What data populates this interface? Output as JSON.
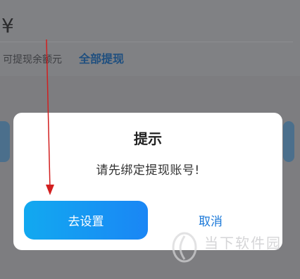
{
  "background": {
    "currency_symbol": "¥",
    "available_label": "可提现余额元",
    "withdraw_all": "全部提现"
  },
  "dialog": {
    "title": "提示",
    "message": "请先绑定提现账号!",
    "confirm_label": "去设置",
    "cancel_label": "取消"
  },
  "watermark": {
    "text": "当下软件园"
  },
  "colors": {
    "overlay": "#7d7d80",
    "dialog_bg": "#ffffff",
    "primary_gradient_start": "#12a9f0",
    "primary_gradient_end": "#1a86f5",
    "cancel_text": "#1a78d8",
    "annotation_arrow": "#d21f1f"
  },
  "icons": {
    "annotation": "red-arrow-icon",
    "watermark_logo": "watermark-logo-icon"
  }
}
